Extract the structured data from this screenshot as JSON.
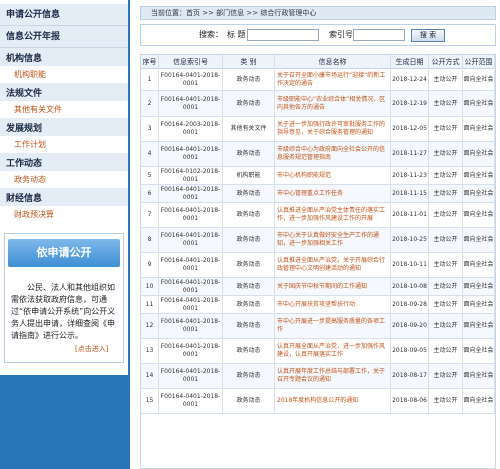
{
  "sidebar": {
    "sections": [
      {
        "label": "申请公开信息"
      },
      {
        "label": "信息公开年报"
      },
      {
        "label": "机构信息",
        "sub": "机构职能"
      },
      {
        "label": "法规文件",
        "sub": "其他有关文件"
      },
      {
        "label": "发展规划",
        "sub": "工作计划"
      },
      {
        "label": "工作动态",
        "sub": "政务动态"
      },
      {
        "label": "财经信息",
        "sub": "财政预决算"
      }
    ],
    "apply": {
      "banner": "依申请公开",
      "text": "公民、法人和其他组织如需依法获取政府信息，可通过“依申请公开系统”向公开义务人提出申请，详细查阅《申请指南》进行公示。",
      "link": "[点击进入]"
    }
  },
  "breadcrumb": "当前位置：首页 >> 部门信息 >> 综合行政管理中心",
  "search": {
    "keyword_label": "搜索：",
    "keyword_prefix": "标 题",
    "docno_label": "索引号",
    "button": "搜 索"
  },
  "table": {
    "headers": [
      "序号",
      "信息索引号",
      "类 别",
      "信息名称",
      "生成日期",
      "公开方式",
      "公开范围"
    ],
    "rows": [
      {
        "no": "1",
        "index": "F00164-0401-2018-0001",
        "cat": "政务动态",
        "title": "关于召开全面小康市场运行“迎接”的新工作决定的通告",
        "date": "2018-12-24",
        "mode": "主动公开",
        "scope": "面向全社会"
      },
      {
        "no": "2",
        "index": "F00164-0401-2018-0001",
        "cat": "政务动态",
        "title": "市级职能中心“农业综合体”相关情况，区内其他各方的通告",
        "date": "2018-12-19",
        "mode": "主动公开",
        "scope": "面向全社会"
      },
      {
        "no": "3",
        "index": "F00164-2003-2018-0001",
        "cat": "其他有关文件",
        "title": "关于进一步加强行政许可审批服务工作的指导意见，关于综合服务管理的通知",
        "date": "2018-12-05",
        "mode": "主动公开",
        "scope": "面向全社会"
      },
      {
        "no": "4",
        "index": "F00164-0401-2018-0001",
        "cat": "政务动态",
        "title": "市级综合中心为政府面向全社会公开的信息服务规范管理指南",
        "date": "2018-11-27",
        "mode": "主动公开",
        "scope": "面向全社会"
      },
      {
        "no": "5",
        "index": "F00164-0102-2018-0001",
        "cat": "机构职能",
        "title": "市中心机构职能规范",
        "date": "2018-11-23",
        "mode": "主动公开",
        "scope": "面向全社会"
      },
      {
        "no": "6",
        "index": "F00164-0401-2018-0001",
        "cat": "政务动态",
        "title": "市中心管理重点工作任务",
        "date": "2018-11-15",
        "mode": "主动公开",
        "scope": "面向全社会"
      },
      {
        "no": "7",
        "index": "F00164-0401-2018-0001",
        "cat": "政务动态",
        "title": "认真推进全面从严治党主体责任的落实工作，进一步加强作风建设工作的开展",
        "date": "2018-11-01",
        "mode": "主动公开",
        "scope": "面向全社会"
      },
      {
        "no": "8",
        "index": "F00164-0401-2018-0001",
        "cat": "政务动态",
        "title": "市中心关于认真做好安全生产工作的通知，进一步加强相关工作",
        "date": "2018-10-25",
        "mode": "主动公开",
        "scope": "面向全社会"
      },
      {
        "no": "9",
        "index": "F00164-0401-2018-0001",
        "cat": "政务动态",
        "title": "认真推进全面从严治党，关于开展综合行政管理中心文明创建活动的通知",
        "date": "2018-10-11",
        "mode": "主动公开",
        "scope": "面向全社会"
      },
      {
        "no": "10",
        "index": "F00164-0401-2018-0001",
        "cat": "政务动态",
        "title": "关于国庆节中秋节期间的工作通知",
        "date": "2018-10-08",
        "mode": "主动公开",
        "scope": "面向全社会"
      },
      {
        "no": "11",
        "index": "F00164-0401-2018-0001",
        "cat": "政务动态",
        "title": "市中心开展扶贫攻坚帮扶行动",
        "date": "2018-09-28",
        "mode": "主动公开",
        "scope": "面向全社会"
      },
      {
        "no": "12",
        "index": "F00164-0401-2018-0001",
        "cat": "政务动态",
        "title": "市中心开展进一步提高服务质量的各项工作",
        "date": "2018-09-20",
        "mode": "主动公开",
        "scope": "面向全社会"
      },
      {
        "no": "13",
        "index": "F00164-0401-2018-0001",
        "cat": "政务动态",
        "title": "认真开展全面从严治党，进一步加强作风建设，认真开展落实工作",
        "date": "2018-09-05",
        "mode": "主动公开",
        "scope": "面向全社会"
      },
      {
        "no": "14",
        "index": "F00164-0401-2018-0001",
        "cat": "政务动态",
        "title": "认真开展年度工作总结与部署工作，关于召开专题会议的通知",
        "date": "2018-08-17",
        "mode": "主动公开",
        "scope": "面向全社会"
      },
      {
        "no": "15",
        "index": "F00164-0401-2018-0001",
        "cat": "政务动态",
        "title": "2018年度机构信息公开的通知",
        "date": "2018-08-06",
        "mode": "主动公开",
        "scope": "面向全社会"
      }
    ]
  }
}
